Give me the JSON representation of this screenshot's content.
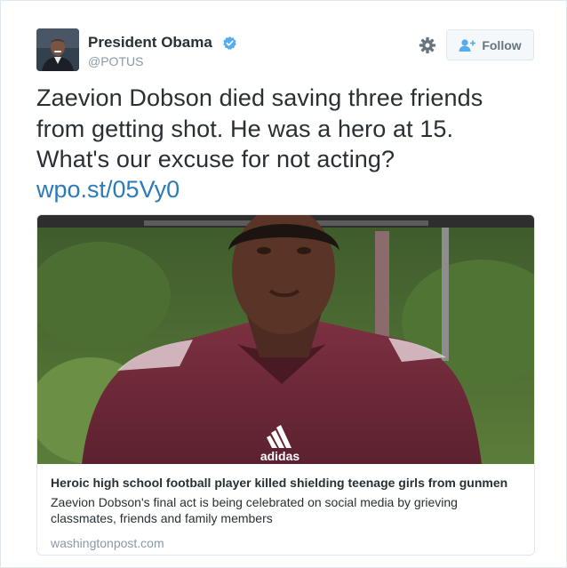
{
  "author": {
    "name": "President Obama",
    "handle": "@POTUS",
    "verified": true
  },
  "actions": {
    "follow_label": "Follow"
  },
  "tweet": {
    "lines": [
      "Zaevion Dobson died saving three friends",
      "from getting shot. He was a hero at 15.",
      "What's our excuse for not acting?"
    ],
    "link": "wpo.st/05Vy0"
  },
  "card": {
    "title": "Heroic high school football player killed shielding teenage girls from gunmen",
    "description": "Zaevion Dobson's final act is being celebrated on social media by grieving classmates, friends and family members",
    "domain": "washingtonpost.com",
    "jersey_brand": "adidas"
  },
  "colors": {
    "link": "#2b7bb9",
    "verified": "#55acee",
    "secondary_text": "#8899a6",
    "border": "#e1e8ed",
    "jersey": "#6e2a35"
  }
}
